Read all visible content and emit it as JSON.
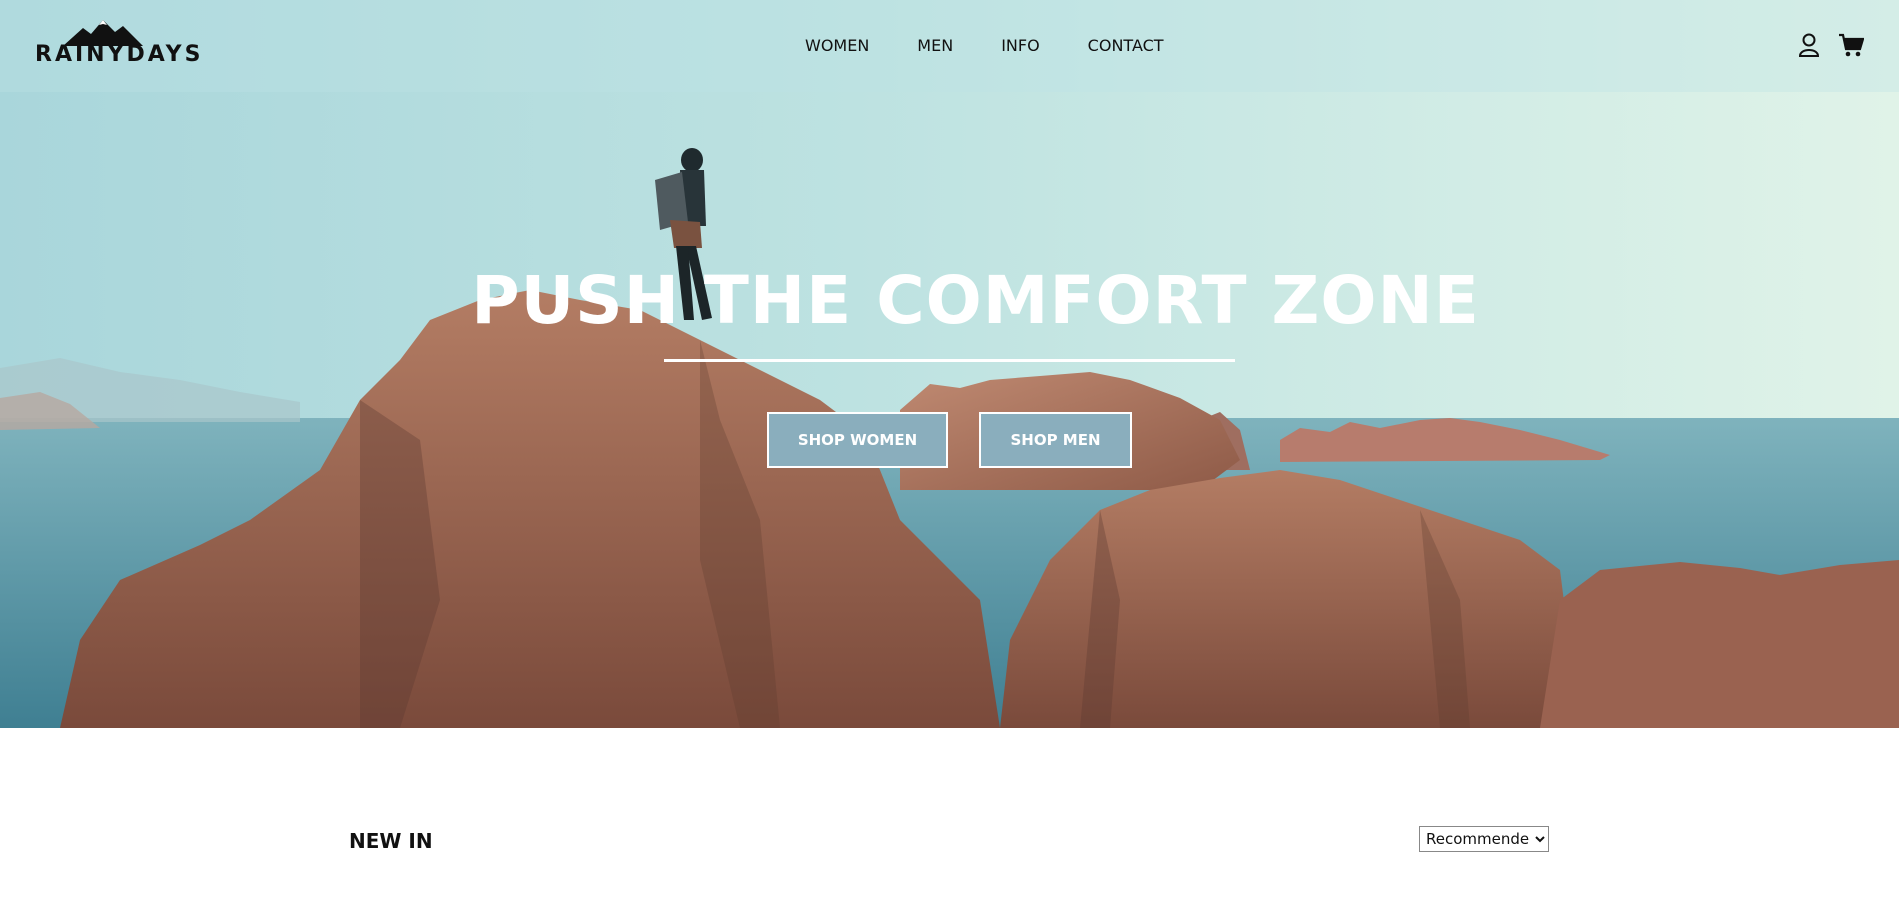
{
  "header": {
    "logo_text": "RAINYDAYS",
    "nav": [
      "WOMEN",
      "MEN",
      "INFO",
      "CONTACT"
    ],
    "icons": {
      "account": "user-icon",
      "cart": "cart-icon"
    }
  },
  "hero": {
    "title": "PUSH THE COMFORT ZONE",
    "buttons": {
      "women": "SHOP WOMEN",
      "men": "SHOP MEN"
    },
    "colors": {
      "button_bg": "#8aaebd",
      "sky": "#bde2e1",
      "sea": "#4f8fa0",
      "rock": "#a56a55"
    }
  },
  "products": {
    "section_title": "NEW IN",
    "sort": {
      "selected": "Recommended",
      "options": [
        "Recommended"
      ]
    }
  }
}
